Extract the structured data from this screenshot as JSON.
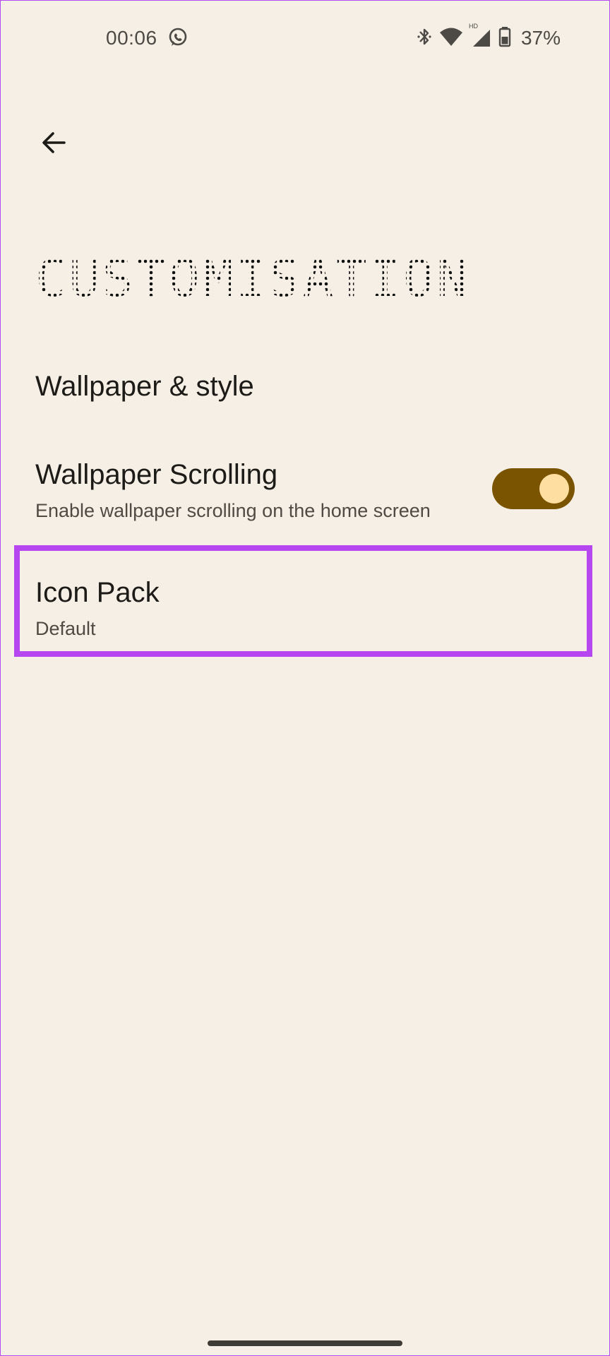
{
  "status_bar": {
    "time": "00:06",
    "battery_percent": "37%",
    "icons": [
      "whatsapp-icon",
      "bluetooth-icon",
      "wifi-icon",
      "cellular-hd-icon",
      "battery-icon"
    ],
    "network_badge": "HD"
  },
  "header": {
    "back_icon": "arrow-left-icon",
    "title": "CUSTOMISATION"
  },
  "settings": {
    "items": [
      {
        "title": "Wallpaper & style"
      },
      {
        "title": "Wallpaper Scrolling",
        "subtitle": "Enable wallpaper scrolling on the home screen",
        "toggle_on": true
      },
      {
        "title": "Icon Pack",
        "subtitle": "Default"
      }
    ]
  },
  "colors": {
    "background": "#f6efe6",
    "toggle_track": "#7a5400",
    "toggle_knob": "#ffdfa1",
    "highlight": "#b646f0"
  }
}
